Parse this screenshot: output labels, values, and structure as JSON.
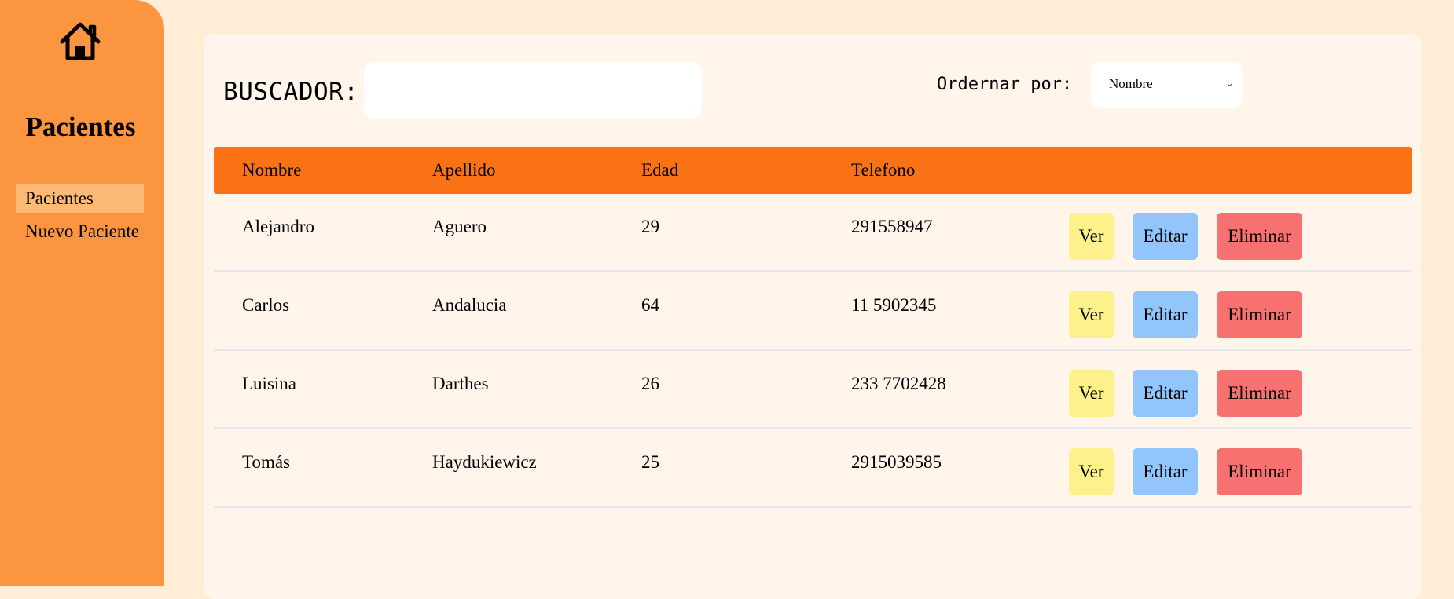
{
  "sidebar": {
    "home_icon": "home-icon",
    "title": "Pacientes",
    "items": [
      {
        "label": "Pacientes",
        "active": true
      },
      {
        "label": "Nuevo Paciente",
        "active": false
      }
    ]
  },
  "search": {
    "label": "BUSCADOR:",
    "value": "",
    "placeholder": ""
  },
  "order": {
    "label": "Ordernar por:",
    "selected": "Nombre"
  },
  "table": {
    "headers": [
      "Nombre",
      "Apellido",
      "Edad",
      "Telefono"
    ],
    "rows": [
      {
        "nombre": "Alejandro",
        "apellido": "Aguero",
        "edad": "29",
        "telefono": "291558947"
      },
      {
        "nombre": "Carlos",
        "apellido": "Andalucia",
        "edad": "64",
        "telefono": "11 5902345"
      },
      {
        "nombre": "Luisina",
        "apellido": "Darthes",
        "edad": "26",
        "telefono": "233 7702428"
      },
      {
        "nombre": "Tomás",
        "apellido": "Haydukiewicz",
        "edad": "25",
        "telefono": "2915039585"
      }
    ],
    "actions": {
      "view": "Ver",
      "edit": "Editar",
      "delete": "Eliminar"
    }
  },
  "colors": {
    "sidebar": "#fb953f",
    "sidebar_active": "#fdba74",
    "page_bg": "#ffedd5",
    "panel_bg": "#fff5eb",
    "header": "#f97316",
    "view_button": "#fef08a",
    "edit_button": "#93c5fd",
    "delete_button": "#f87171"
  }
}
